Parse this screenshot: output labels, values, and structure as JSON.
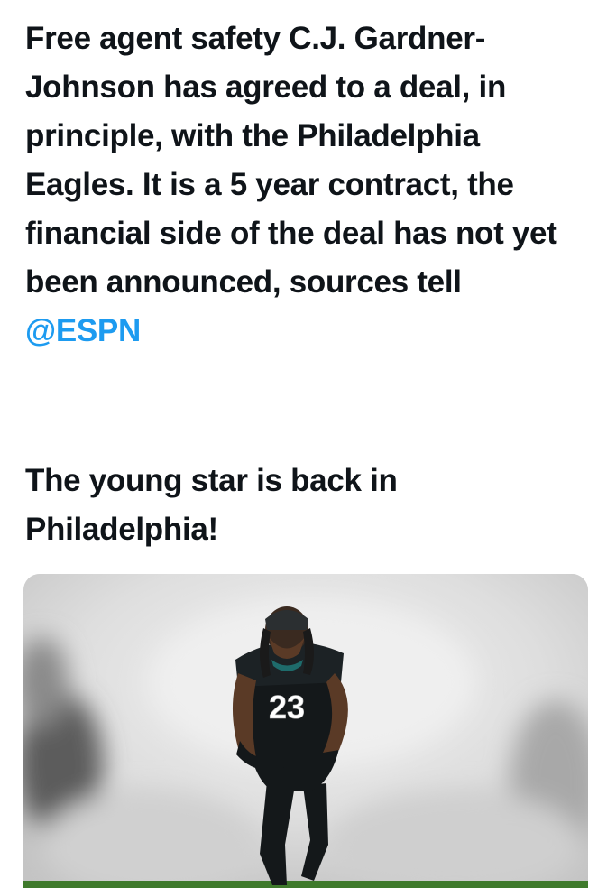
{
  "post": {
    "paragraph1": "Free agent safety C.J. Gardner-Johnson has agreed to a deal, in principle, with the Philadelphia Eagles. It is a 5 year contract, the financial side of the deal has not yet been announced, sources tell",
    "mention": "@ESPN",
    "paragraph2": "The young star is back in Philadelphia!"
  },
  "media": {
    "jersey_number": "23",
    "colors": {
      "smoke_light": "#ececec",
      "smoke_mid": "#c9c9c9",
      "smoke_dark": "#4a4a4a",
      "jersey": "#14181a",
      "turf": "#3f7a2c",
      "mention": "#1d9bf0"
    }
  }
}
